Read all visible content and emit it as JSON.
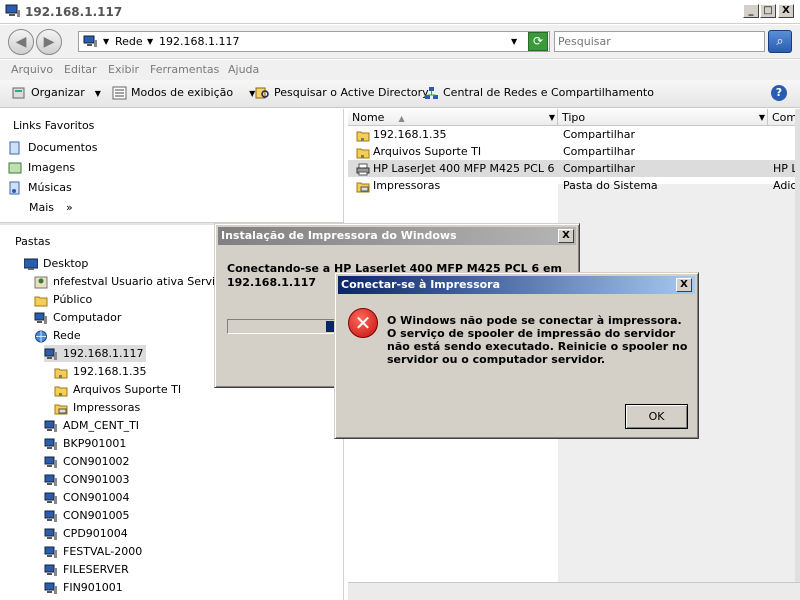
{
  "window": {
    "title": "192.168.1.117",
    "minimize": "_",
    "maximize": "□",
    "close": "X"
  },
  "address": {
    "root": "Rede",
    "host": "192.168.1.117",
    "search_placeholder": "Pesquisar"
  },
  "menu": [
    "Arquivo",
    "Editar",
    "Exibir",
    "Ferramentas",
    "Ajuda"
  ],
  "toolbar": {
    "organize": "Organizar",
    "views": "Modos de exibição",
    "search_ad": "Pesquisar o Active Directory",
    "network_center": "Central de Redes e Compartilhamento"
  },
  "favorites": {
    "heading": "Links Favoritos",
    "items": [
      "Documentos",
      "Imagens",
      "Músicas"
    ],
    "more": "Mais",
    "more_arrow": "»"
  },
  "folders": {
    "heading": "Pastas",
    "tree": [
      {
        "label": "Desktop",
        "icon": "desktop-icon"
      },
      {
        "label": "nfefestval Usuario  ativa Servidor",
        "icon": "user-folder-icon"
      },
      {
        "label": "Público",
        "icon": "folder-icon"
      },
      {
        "label": "Computador",
        "icon": "computer-icon"
      },
      {
        "label": "Rede",
        "icon": "network-icon"
      },
      {
        "label": "192.168.1.117",
        "icon": "computer-icon"
      },
      {
        "label": "192.168.1.35",
        "icon": "shared-folder-icon"
      },
      {
        "label": "Arquivos Suporte TI",
        "icon": "shared-folder-icon"
      },
      {
        "label": "Impressoras",
        "icon": "printers-folder-icon"
      },
      {
        "label": "ADM_CENT_TI",
        "icon": "computer-icon"
      },
      {
        "label": "BKP901001",
        "icon": "computer-icon"
      },
      {
        "label": "CON901002",
        "icon": "computer-icon"
      },
      {
        "label": "CON901003",
        "icon": "computer-icon"
      },
      {
        "label": "CON901004",
        "icon": "computer-icon"
      },
      {
        "label": "CON901005",
        "icon": "computer-icon"
      },
      {
        "label": "CPD901004",
        "icon": "computer-icon"
      },
      {
        "label": "FESTVAL-2000",
        "icon": "computer-icon"
      },
      {
        "label": "FILESERVER",
        "icon": "computer-icon"
      },
      {
        "label": "FIN901001",
        "icon": "computer-icon"
      }
    ]
  },
  "list": {
    "columns": [
      "Nome",
      "Tipo",
      "Come"
    ],
    "rows": [
      {
        "name": "192.168.1.35",
        "type": "Compartilhar",
        "comment": "",
        "icon": "shared-folder-icon"
      },
      {
        "name": "Arquivos Suporte TI",
        "type": "Compartilhar",
        "comment": "",
        "icon": "shared-folder-icon"
      },
      {
        "name": "HP LaserJet 400 MFP M425 PCL 6",
        "type": "Compartilhar",
        "comment": "HP La",
        "icon": "printer-icon"
      },
      {
        "name": "Impressoras",
        "type": "Pasta do Sistema",
        "comment": "Adici",
        "icon": "printers-folder-icon"
      }
    ]
  },
  "install_dialog": {
    "title": "Instalação de Impressora do Windows",
    "message_line1": "Conectando-se a HP LaserJet 400 MFP M425 PCL 6 em",
    "message_line2": "192.168.1.117",
    "close": "X"
  },
  "error_dialog": {
    "title": "Conectar-se à Impressora",
    "message": "O Windows não pode se conectar à impressora. O serviço de spooler de impressão do servidor não está sendo executado. Reinicie o spooler no servidor ou o computador servidor.",
    "ok": "OK",
    "close": "X",
    "icon_glyph": "✕"
  }
}
